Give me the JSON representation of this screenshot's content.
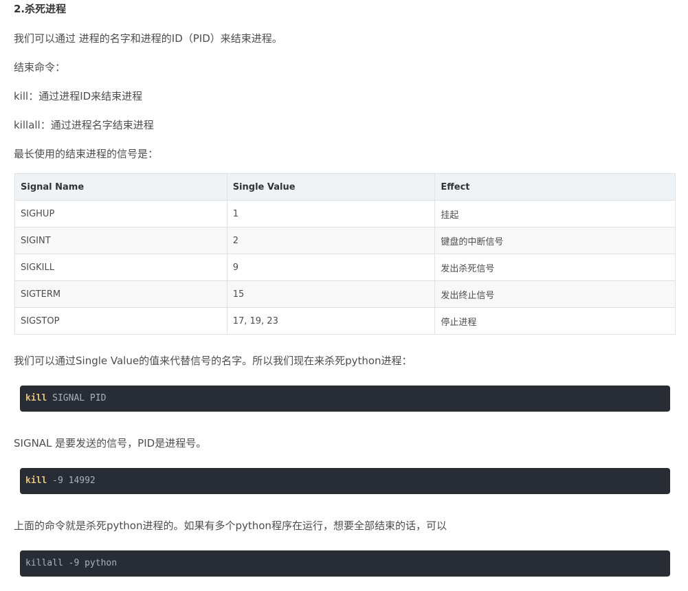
{
  "heading": "2.杀死进程",
  "para1": "我们可以通过 进程的名字和进程的ID（PID）来结束进程。",
  "para2": "结束命令：",
  "para3": "kill：通过进程ID来结束进程",
  "para4": "killall：通过进程名字结束进程",
  "para5": "最长使用的结束进程的信号是：",
  "table": {
    "headers": [
      "Signal Name",
      "Single Value",
      "Effect"
    ],
    "rows": [
      [
        "SIGHUP",
        "1",
        "挂起"
      ],
      [
        "SIGINT",
        "2",
        "键盘的中断信号"
      ],
      [
        "SIGKILL",
        "9",
        "发出杀死信号"
      ],
      [
        "SIGTERM",
        "15",
        "发出终止信号"
      ],
      [
        "SIGSTOP",
        "17, 19, 23",
        "停止进程"
      ]
    ]
  },
  "para6": "我们可以通过Single Value的值来代替信号的名字。所以我们现在来杀死python进程：",
  "code1": {
    "keyword": "kill",
    "rest": " SIGNAL PID"
  },
  "para7": "SIGNAL 是要发送的信号，PID是进程号。",
  "code2": {
    "keyword": "kill",
    "rest": " -9 14992"
  },
  "para8": "上面的命令就是杀死python进程的。如果有多个python程序在运行，想要全部结束的话，可以",
  "code3": {
    "text": "killall -9 python"
  }
}
